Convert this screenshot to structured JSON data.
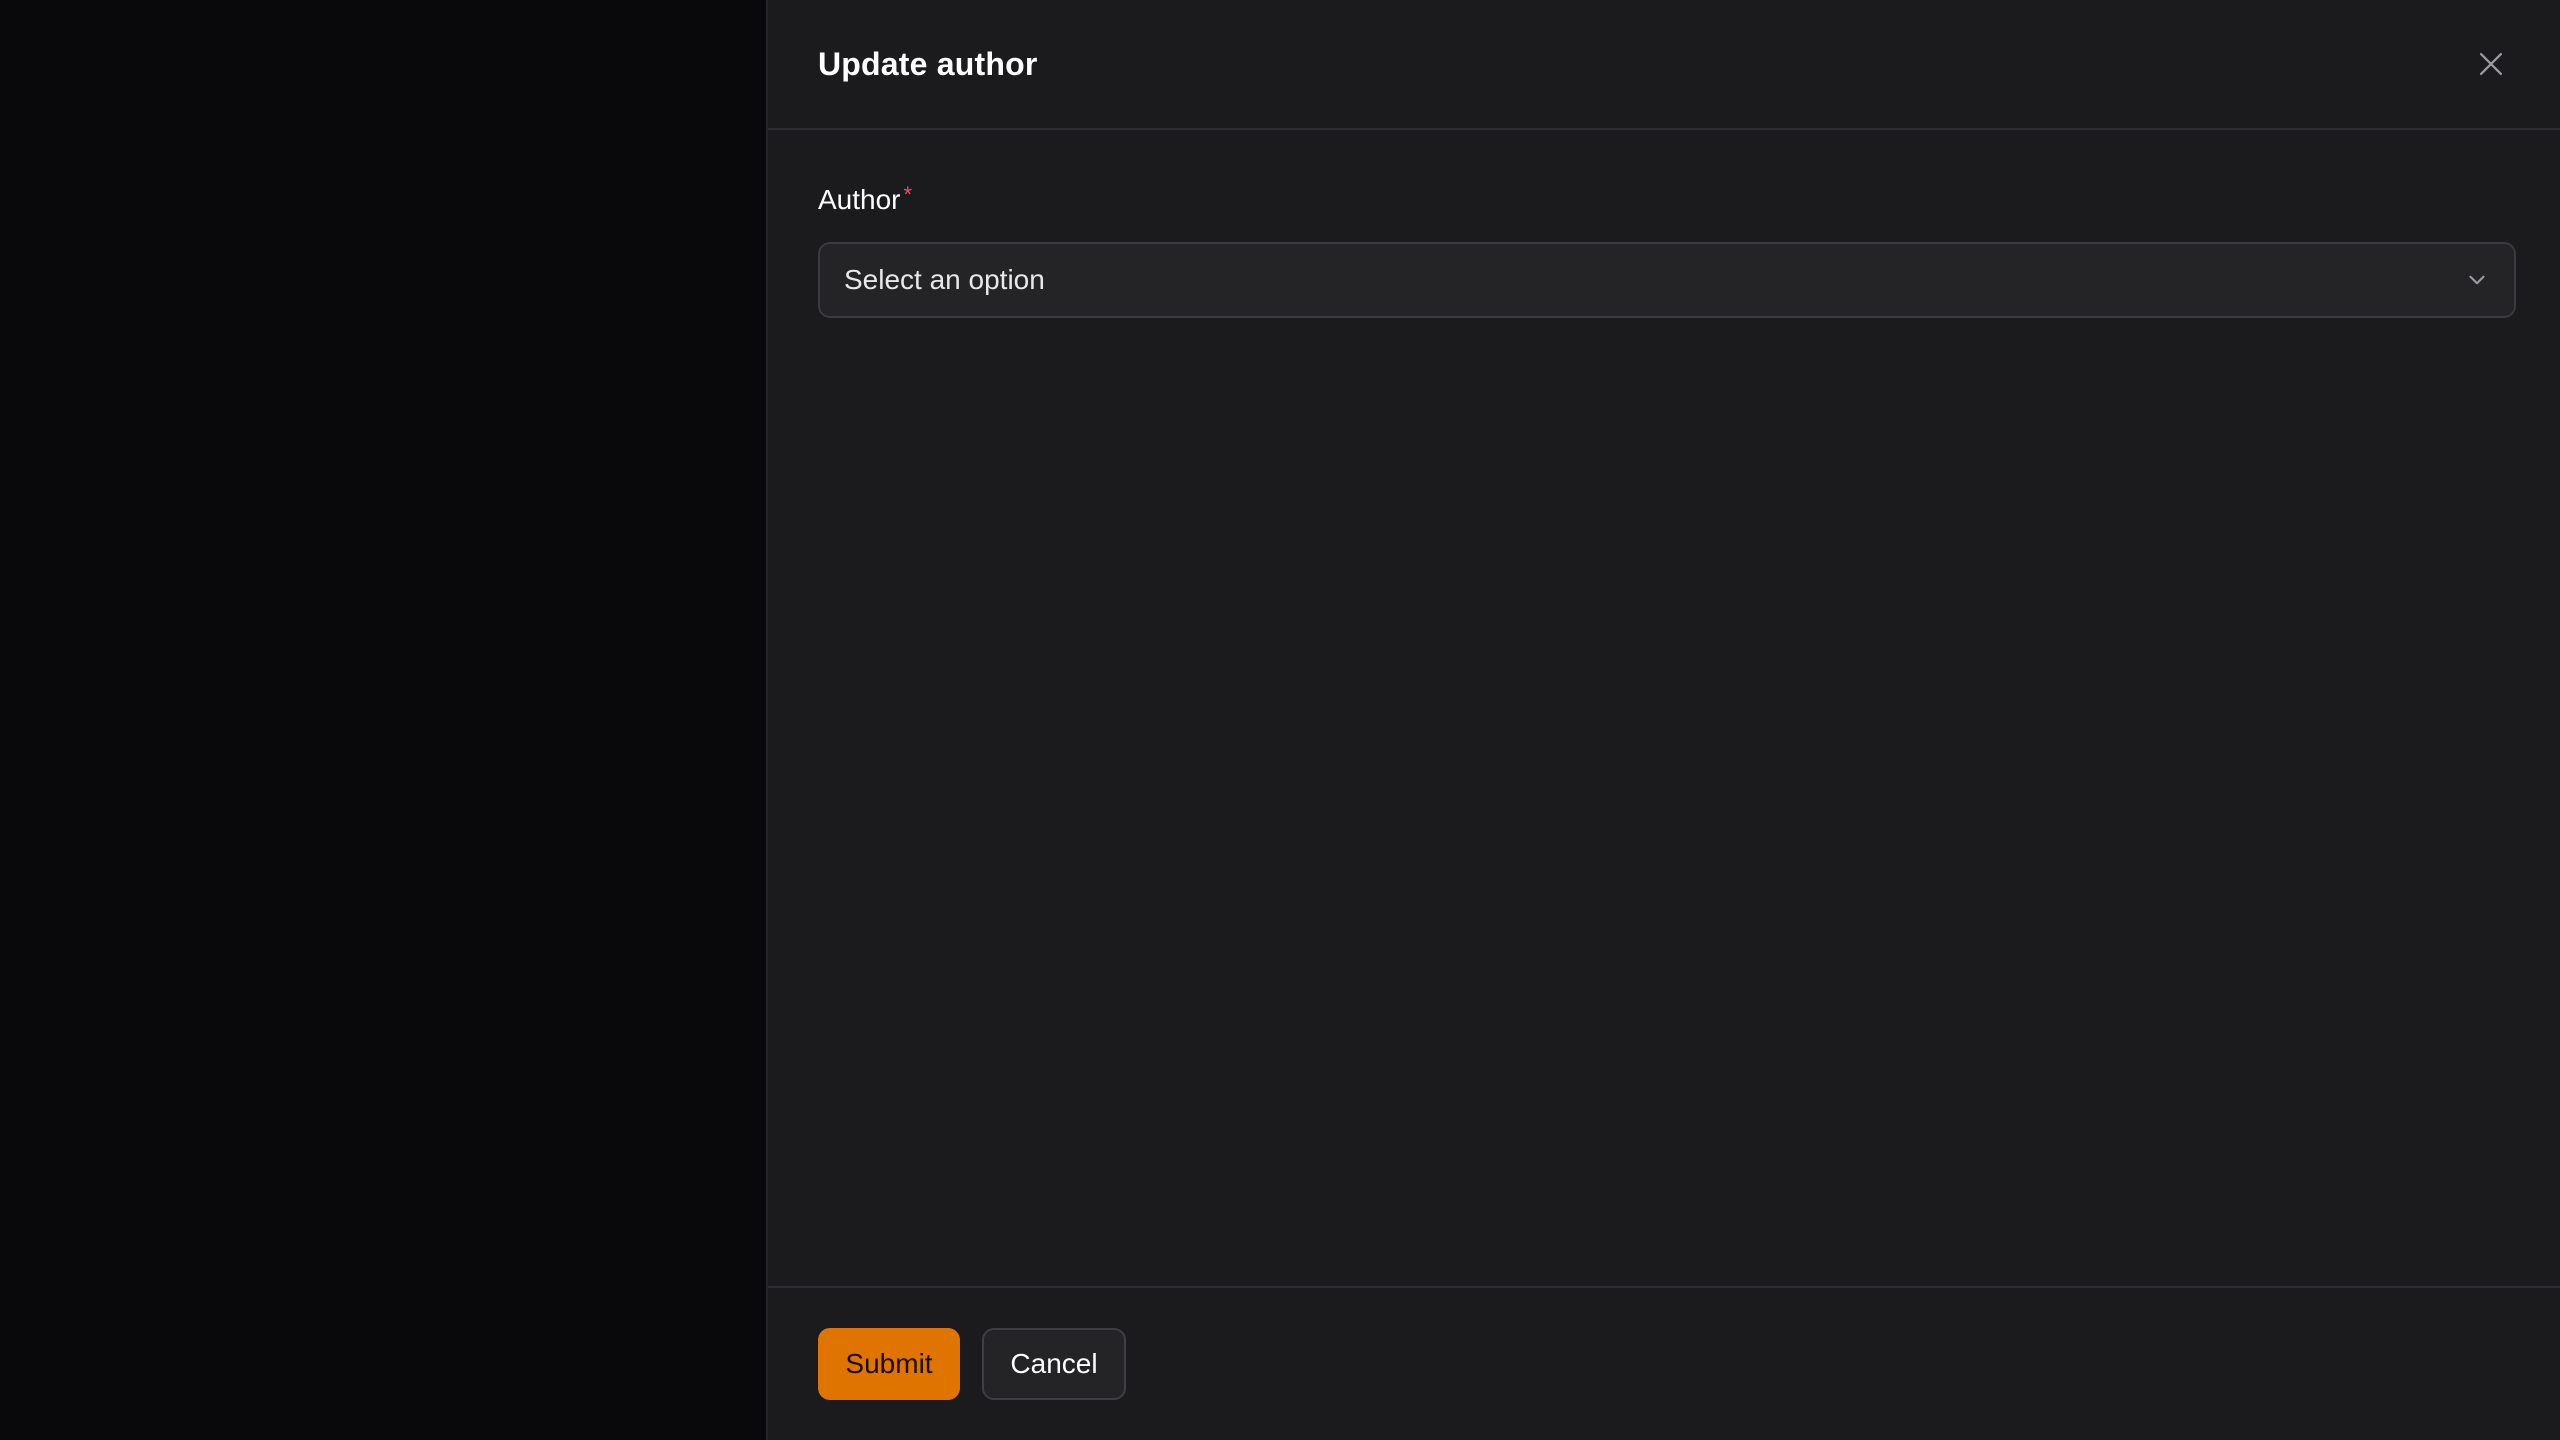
{
  "panel": {
    "title": "Update author"
  },
  "form": {
    "author_label": "Author",
    "required_marker": "*",
    "author_select_value": "Select an option"
  },
  "footer": {
    "submit_label": "Submit",
    "cancel_label": "Cancel"
  },
  "colors": {
    "accent": "#e07400",
    "required": "#f0535d",
    "panel_bg": "#1b1b1e",
    "backdrop": "#09090b"
  },
  "icons": {
    "close": "close-icon",
    "select_chevron": "chevron-down-icon"
  }
}
